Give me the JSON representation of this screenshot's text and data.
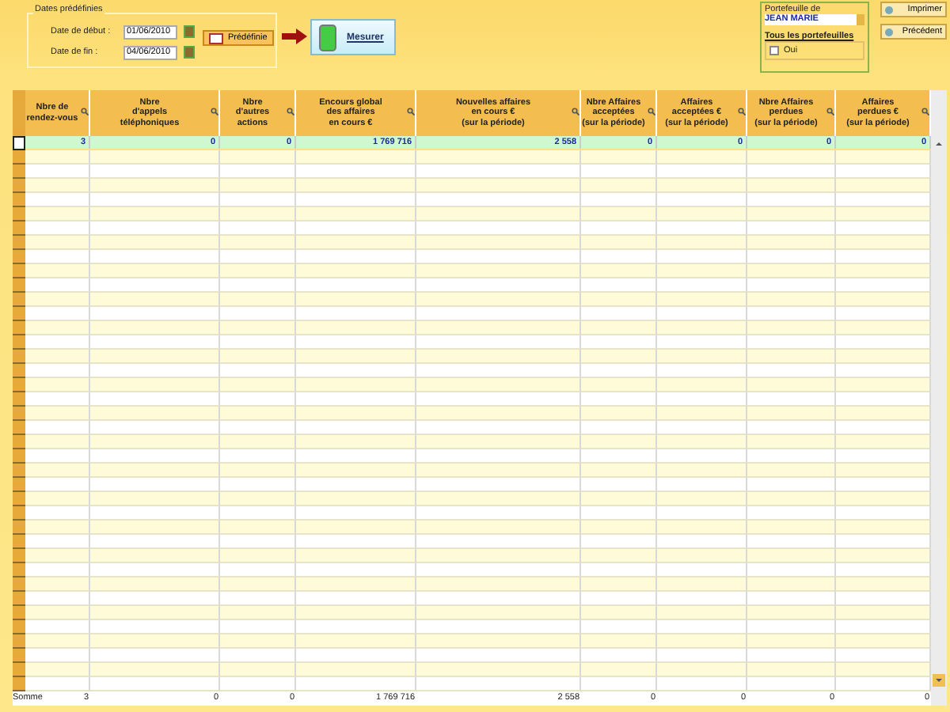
{
  "filters": {
    "legend": "Dates prédéfinies",
    "start_label": "Date de début :",
    "start_value": "01/06/2010",
    "end_label": "Date de fin :",
    "end_value": "04/06/2010",
    "predefined_button": "Prédéfinie"
  },
  "measure_button": "Mesurer",
  "portfolio": {
    "label": "Portefeuille de",
    "value": "JEAN MARIE",
    "all_label": "Tous les portefeuilles",
    "checkbox": {
      "label": "Oui",
      "checked": false
    }
  },
  "buttons": [
    "Imprimer",
    "Précédent"
  ],
  "table": {
    "columns": [
      "Nbre de\nrendez-vous",
      "Nbre\nd'appels\ntéléphoniques",
      "Nbre\nd'autres\nactions",
      "Encours global\ndes affaires\nen cours €",
      "Nouvelles affaires\nen cours €\n(sur la période)",
      "Nbre Affaires\nacceptées\n(sur la période)",
      "Affaires\nacceptées €\n(sur la période)",
      "Nbre Affaires\nperdues\n(sur la période)",
      "Affaires\nperdues €\n(sur la période)"
    ],
    "rows": [
      {
        "selected": true,
        "cells": [
          "3",
          "0",
          "0",
          "1 769 716",
          "2 558",
          "0",
          "0",
          "0",
          "0"
        ]
      }
    ],
    "totals_label": "Somme",
    "totals": [
      "3",
      "0",
      "0",
      "1 769 716",
      "2 558",
      "0",
      "0",
      "0",
      "0"
    ]
  }
}
